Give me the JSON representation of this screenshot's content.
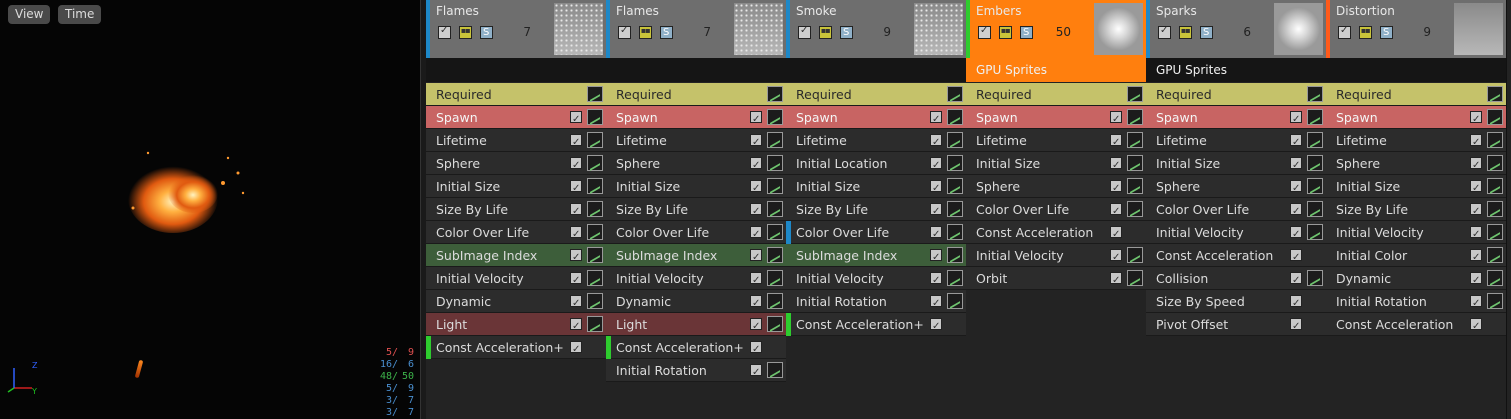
{
  "viewport": {
    "view_label": "View",
    "time_label": "Time",
    "stats": [
      {
        "a": "5/",
        "b": "9",
        "color": "#e05050"
      },
      {
        "a": "16/",
        "b": "6",
        "color": "#4a8fd0"
      },
      {
        "a": "48/",
        "b": "50",
        "color": "#3cb34a"
      },
      {
        "a": "5/",
        "b": "9",
        "color": "#4a8fd0"
      },
      {
        "a": "3/",
        "b": "7",
        "color": "#4a8fd0"
      },
      {
        "a": "3/",
        "b": "7",
        "color": "#4a8fd0"
      }
    ],
    "axis": {
      "z": "Z",
      "y": "Y"
    }
  },
  "emitters": [
    {
      "name": "Flames",
      "count": "7",
      "accent": "#1e88c8",
      "header_bg": "#6e6e6e",
      "thumb": "dots",
      "type_label": "",
      "modules": [
        {
          "label": "Required",
          "kind": "required",
          "check": false,
          "graph": true
        },
        {
          "label": "Spawn",
          "kind": "spawn",
          "check": true,
          "graph": true
        },
        {
          "label": "Lifetime",
          "kind": "normal",
          "check": true,
          "graph": true
        },
        {
          "label": "Sphere",
          "kind": "normal",
          "check": true,
          "graph": true
        },
        {
          "label": "Initial Size",
          "kind": "normal",
          "check": true,
          "graph": true
        },
        {
          "label": "Size By Life",
          "kind": "normal",
          "check": true,
          "graph": true
        },
        {
          "label": "Color Over Life",
          "kind": "normal",
          "check": true,
          "graph": true
        },
        {
          "label": "SubImage Index",
          "kind": "subimage",
          "check": true,
          "graph": true
        },
        {
          "label": "Initial Velocity",
          "kind": "normal",
          "check": true,
          "graph": true
        },
        {
          "label": "Dynamic",
          "kind": "normal",
          "check": true,
          "graph": true
        },
        {
          "label": "Light",
          "kind": "light",
          "check": true,
          "graph": true
        },
        {
          "label": "Const Acceleration+",
          "kind": "normal",
          "check": true,
          "graph": false,
          "mark": "#2ecc2e"
        }
      ]
    },
    {
      "name": "Flames",
      "count": "7",
      "accent": "#1e88c8",
      "header_bg": "#6e6e6e",
      "thumb": "dots",
      "type_label": "",
      "modules": [
        {
          "label": "Required",
          "kind": "required",
          "check": false,
          "graph": true
        },
        {
          "label": "Spawn",
          "kind": "spawn",
          "check": true,
          "graph": true
        },
        {
          "label": "Lifetime",
          "kind": "normal",
          "check": true,
          "graph": true
        },
        {
          "label": "Sphere",
          "kind": "normal",
          "check": true,
          "graph": true
        },
        {
          "label": "Initial Size",
          "kind": "normal",
          "check": true,
          "graph": true
        },
        {
          "label": "Size By Life",
          "kind": "normal",
          "check": true,
          "graph": true
        },
        {
          "label": "Color Over Life",
          "kind": "normal",
          "check": true,
          "graph": true
        },
        {
          "label": "SubImage Index",
          "kind": "subimage",
          "check": true,
          "graph": true
        },
        {
          "label": "Initial Velocity",
          "kind": "normal",
          "check": true,
          "graph": true
        },
        {
          "label": "Dynamic",
          "kind": "normal",
          "check": true,
          "graph": true
        },
        {
          "label": "Light",
          "kind": "light",
          "check": true,
          "graph": true
        },
        {
          "label": "Const Acceleration+",
          "kind": "normal",
          "check": true,
          "graph": false,
          "mark": "#2ecc2e"
        },
        {
          "label": "Initial Rotation",
          "kind": "normal",
          "check": true,
          "graph": true
        }
      ]
    },
    {
      "name": "Smoke",
      "count": "9",
      "accent": "#1e88c8",
      "header_bg": "#6e6e6e",
      "thumb": "dots",
      "type_label": "",
      "modules": [
        {
          "label": "Required",
          "kind": "required",
          "check": false,
          "graph": true
        },
        {
          "label": "Spawn",
          "kind": "spawn",
          "check": true,
          "graph": true
        },
        {
          "label": "Lifetime",
          "kind": "normal",
          "check": true,
          "graph": true
        },
        {
          "label": "Initial Location",
          "kind": "normal",
          "check": true,
          "graph": true
        },
        {
          "label": "Initial Size",
          "kind": "normal",
          "check": true,
          "graph": true
        },
        {
          "label": "Size By Life",
          "kind": "normal",
          "check": true,
          "graph": true
        },
        {
          "label": "Color Over Life",
          "kind": "normal",
          "check": true,
          "graph": true,
          "mark": "#1e88c8"
        },
        {
          "label": "SubImage Index",
          "kind": "subimage",
          "check": true,
          "graph": true
        },
        {
          "label": "Initial Velocity",
          "kind": "normal",
          "check": true,
          "graph": true
        },
        {
          "label": "Initial Rotation",
          "kind": "normal",
          "check": true,
          "graph": true
        },
        {
          "label": "Const Acceleration+",
          "kind": "normal",
          "check": true,
          "graph": false,
          "mark": "#2ecc2e"
        }
      ]
    },
    {
      "name": "Embers",
      "count": "50",
      "accent": "#2ecc2e",
      "header_bg": "#ff7f0e",
      "thumb": "glow",
      "type_label": "GPU Sprites",
      "type_bg": "#ff7f0e",
      "modules": [
        {
          "label": "Required",
          "kind": "required",
          "check": false,
          "graph": true
        },
        {
          "label": "Spawn",
          "kind": "spawn",
          "check": true,
          "graph": true
        },
        {
          "label": "Lifetime",
          "kind": "normal",
          "check": true,
          "graph": true
        },
        {
          "label": "Initial Size",
          "kind": "normal",
          "check": true,
          "graph": true
        },
        {
          "label": "Sphere",
          "kind": "normal",
          "check": true,
          "graph": true
        },
        {
          "label": "Color Over Life",
          "kind": "normal",
          "check": true,
          "graph": true
        },
        {
          "label": "Const Acceleration",
          "kind": "normal",
          "check": true,
          "graph": false
        },
        {
          "label": "Initial Velocity",
          "kind": "normal",
          "check": true,
          "graph": true
        },
        {
          "label": "Orbit",
          "kind": "normal",
          "check": true,
          "graph": true
        }
      ]
    },
    {
      "name": "Sparks",
      "count": "6",
      "accent": "#1e88c8",
      "header_bg": "#6e6e6e",
      "thumb": "glow",
      "type_label": "GPU Sprites",
      "type_bg": "#151515",
      "modules": [
        {
          "label": "Required",
          "kind": "required",
          "check": false,
          "graph": true
        },
        {
          "label": "Spawn",
          "kind": "spawn",
          "check": true,
          "graph": true
        },
        {
          "label": "Lifetime",
          "kind": "normal",
          "check": true,
          "graph": true
        },
        {
          "label": "Initial Size",
          "kind": "normal",
          "check": true,
          "graph": true
        },
        {
          "label": "Sphere",
          "kind": "normal",
          "check": true,
          "graph": true
        },
        {
          "label": "Color Over Life",
          "kind": "normal",
          "check": true,
          "graph": true
        },
        {
          "label": "Initial Velocity",
          "kind": "normal",
          "check": true,
          "graph": true
        },
        {
          "label": "Const Acceleration",
          "kind": "normal",
          "check": true,
          "graph": false
        },
        {
          "label": "Collision",
          "kind": "normal",
          "check": true,
          "graph": true
        },
        {
          "label": "Size By Speed",
          "kind": "normal",
          "check": true,
          "graph": false
        },
        {
          "label": "Pivot Offset",
          "kind": "normal",
          "check": true,
          "graph": false
        }
      ]
    },
    {
      "name": "Distortion",
      "count": "9",
      "accent": "#ff5a1a",
      "header_bg": "#6e6e6e",
      "thumb": "plain",
      "type_label": "",
      "modules": [
        {
          "label": "Required",
          "kind": "required",
          "check": false,
          "graph": true
        },
        {
          "label": "Spawn",
          "kind": "spawn",
          "check": true,
          "graph": true
        },
        {
          "label": "Lifetime",
          "kind": "normal",
          "check": true,
          "graph": true
        },
        {
          "label": "Sphere",
          "kind": "normal",
          "check": true,
          "graph": true
        },
        {
          "label": "Initial Size",
          "kind": "normal",
          "check": true,
          "graph": true
        },
        {
          "label": "Size By Life",
          "kind": "normal",
          "check": true,
          "graph": true
        },
        {
          "label": "Initial Velocity",
          "kind": "normal",
          "check": true,
          "graph": true
        },
        {
          "label": "Initial Color",
          "kind": "normal",
          "check": true,
          "graph": true
        },
        {
          "label": "Dynamic",
          "kind": "normal",
          "check": true,
          "graph": true
        },
        {
          "label": "Initial Rotation",
          "kind": "normal",
          "check": true,
          "graph": true
        },
        {
          "label": "Const Acceleration",
          "kind": "normal",
          "check": true,
          "graph": false
        }
      ]
    }
  ]
}
